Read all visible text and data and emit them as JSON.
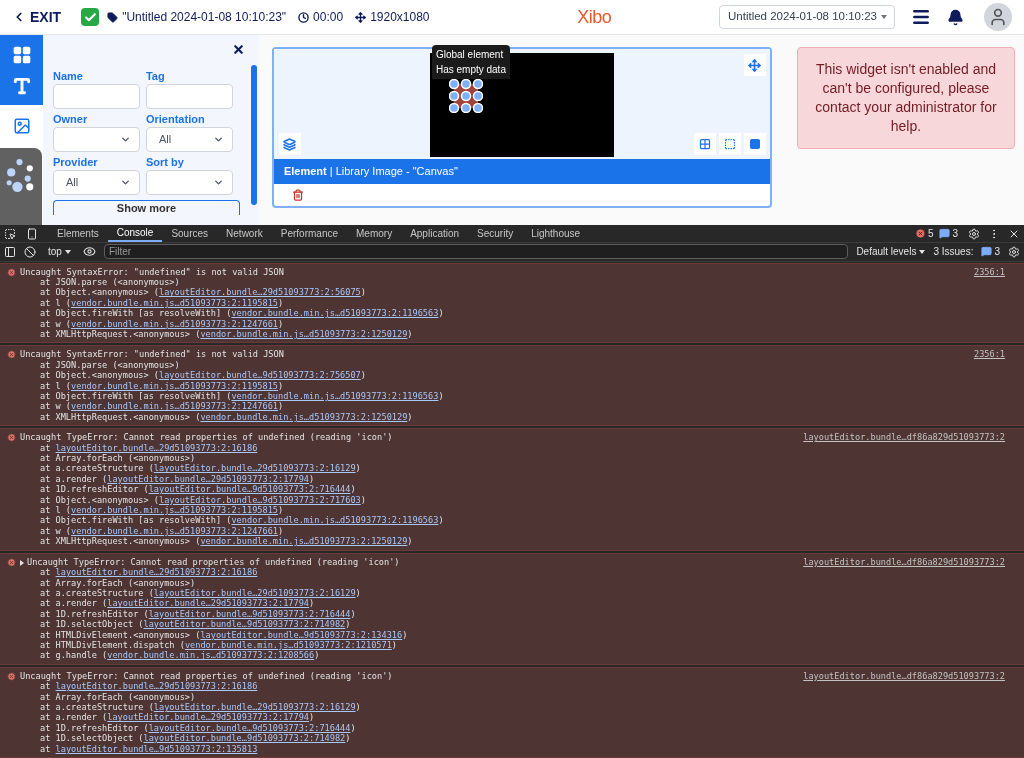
{
  "top_bar": {
    "exit": "EXIT",
    "layout_name": "\"Untitled 2024-01-08 10:10:23\"",
    "duration": "00:00",
    "resolution": "1920x1080",
    "logo": "Xibo",
    "layout_select": "Untitled 2024-01-08 10:10:23"
  },
  "toolbox": {
    "filters": [
      {
        "label": "Name",
        "kind": "input"
      },
      {
        "label": "Tag",
        "kind": "input"
      },
      {
        "label": "Owner",
        "kind": "select"
      },
      {
        "label": "Orientation",
        "kind": "select",
        "value": "All"
      },
      {
        "label": "Provider",
        "kind": "select",
        "value": "All"
      },
      {
        "label": "Sort by",
        "kind": "select"
      }
    ],
    "show_more": "Show more"
  },
  "canvas": {
    "tooltip": [
      "Global element",
      "Has empty data"
    ],
    "element_bar": "**Element** | Library Image - \"Canvas\""
  },
  "warning": "This widget isn't enabled and can't be configured, please contact your administrator for help.",
  "devtools": {
    "tabs": [
      {
        "label": "Elements",
        "selected": false
      },
      {
        "label": "Console",
        "selected": true
      },
      {
        "label": "Sources",
        "selected": false
      },
      {
        "label": "Network",
        "selected": false
      },
      {
        "label": "Performance",
        "selected": false
      },
      {
        "label": "Memory",
        "selected": false
      },
      {
        "label": "Application",
        "selected": false
      },
      {
        "label": "Security",
        "selected": false
      },
      {
        "label": "Lighthouse",
        "selected": false
      }
    ],
    "error_count": "5",
    "message_count": "3",
    "context": "top",
    "filter_placeholder": "Filter",
    "levels": "Default levels",
    "issues_label": "3 Issues:",
    "issues_count": "3"
  },
  "messages": [
    {
      "expandable": false,
      "text": "Uncaught SyntaxError: \"undefined\" is not valid JSON",
      "source": "2356:1",
      "frames": [
        {
          "text": "at JSON.parse (<anonymous>)"
        },
        {
          "text": "at Object.<anonymous> (",
          "link": "layoutEditor.bundle…29d51093773:2:56075",
          "end": ")"
        },
        {
          "text": "at l (",
          "link": "vendor.bundle.min.js…d51093773:2:1195815",
          "end": ")"
        },
        {
          "text": "at Object.fireWith [as resolveWith] (",
          "link": "vendor.bundle.min.js…d51093773:2:1196563",
          "end": ")"
        },
        {
          "text": "at w (",
          "link": "vendor.bundle.min.js…d51093773:2:1247661",
          "end": ")"
        },
        {
          "text": "at XMLHttpRequest.<anonymous> (",
          "link": "vendor.bundle.min.js…d51093773:2:1250129",
          "end": ")"
        }
      ]
    },
    {
      "expandable": false,
      "text": "Uncaught SyntaxError: \"undefined\" is not valid JSON",
      "source": "2356:1",
      "frames": [
        {
          "text": "at JSON.parse (<anonymous>)"
        },
        {
          "text": "at Object.<anonymous> (",
          "link": "layoutEditor.bundle…9d51093773:2:756507",
          "end": ")"
        },
        {
          "text": "at l (",
          "link": "vendor.bundle.min.js…d51093773:2:1195815",
          "end": ")"
        },
        {
          "text": "at Object.fireWith [as resolveWith] (",
          "link": "vendor.bundle.min.js…d51093773:2:1196563",
          "end": ")"
        },
        {
          "text": "at w (",
          "link": "vendor.bundle.min.js…d51093773:2:1247661",
          "end": ")"
        },
        {
          "text": "at XMLHttpRequest.<anonymous> (",
          "link": "vendor.bundle.min.js…d51093773:2:1250129",
          "end": ")"
        }
      ]
    },
    {
      "expandable": false,
      "text": "Uncaught TypeError: Cannot read properties of undefined (reading 'icon')",
      "source": "layoutEditor.bundle…df86a829d51093773:2",
      "frames": [
        {
          "text": "at ",
          "link": "layoutEditor.bundle…29d51093773:2:16186"
        },
        {
          "text": "at Array.forEach (<anonymous>)"
        },
        {
          "text": "at a.createStructure (",
          "link": "layoutEditor.bundle…29d51093773:2:16129",
          "end": ")"
        },
        {
          "text": "at a.render (",
          "link": "layoutEditor.bundle…29d51093773:2:17794",
          "end": ")"
        },
        {
          "text": "at 1D.refreshEditor (",
          "link": "layoutEditor.bundle…9d51093773:2:716444",
          "end": ")"
        },
        {
          "text": "at Object.<anonymous> (",
          "link": "layoutEditor.bundle…9d51093773:2:717603",
          "end": ")"
        },
        {
          "text": "at l (",
          "link": "vendor.bundle.min.js…d51093773:2:1195815",
          "end": ")"
        },
        {
          "text": "at Object.fireWith [as resolveWith] (",
          "link": "vendor.bundle.min.js…d51093773:2:1196563",
          "end": ")"
        },
        {
          "text": "at w (",
          "link": "vendor.bundle.min.js…d51093773:2:1247661",
          "end": ")"
        },
        {
          "text": "at XMLHttpRequest.<anonymous> (",
          "link": "vendor.bundle.min.js…d51093773:2:1250129",
          "end": ")"
        }
      ]
    },
    {
      "expandable": true,
      "text": "Uncaught TypeError: Cannot read properties of undefined (reading 'icon')",
      "source": "layoutEditor.bundle…df86a829d51093773:2",
      "frames": [
        {
          "text": "at ",
          "link": "layoutEditor.bundle…29d51093773:2:16186"
        },
        {
          "text": "at Array.forEach (<anonymous>)"
        },
        {
          "text": "at a.createStructure (",
          "link": "layoutEditor.bundle…29d51093773:2:16129",
          "end": ")"
        },
        {
          "text": "at a.render (",
          "link": "layoutEditor.bundle…29d51093773:2:17794",
          "end": ")"
        },
        {
          "text": "at 1D.refreshEditor (",
          "link": "layoutEditor.bundle…9d51093773:2:716444",
          "end": ")"
        },
        {
          "text": "at 1D.selectObject (",
          "link": "layoutEditor.bundle…9d51093773:2:714982",
          "end": ")"
        },
        {
          "text": "at HTMLDivElement.<anonymous> (",
          "link": "layoutEditor.bundle…9d51093773:2:134316",
          "end": ")"
        },
        {
          "text": "at HTMLDivElement.dispatch (",
          "link": "vendor.bundle.min.js…d51093773:2:1210571",
          "end": ")"
        },
        {
          "text": "at g.handle (",
          "link": "vendor.bundle.min.js…d51093773:2:1208566",
          "end": ")"
        }
      ]
    },
    {
      "expandable": false,
      "text": "Uncaught TypeError: Cannot read properties of undefined (reading 'icon')",
      "source": "layoutEditor.bundle…df86a829d51093773:2",
      "frames": [
        {
          "text": "at ",
          "link": "layoutEditor.bundle…29d51093773:2:16186"
        },
        {
          "text": "at Array.forEach (<anonymous>)"
        },
        {
          "text": "at a.createStructure (",
          "link": "layoutEditor.bundle…29d51093773:2:16129",
          "end": ")"
        },
        {
          "text": "at a.render (",
          "link": "layoutEditor.bundle…29d51093773:2:17794",
          "end": ")"
        },
        {
          "text": "at 1D.refreshEditor (",
          "link": "layoutEditor.bundle…9d51093773:2:716444",
          "end": ")"
        },
        {
          "text": "at 1D.selectObject (",
          "link": "layoutEditor.bundle…9d51093773:2:714982",
          "end": ")"
        },
        {
          "text": "at ",
          "link": "layoutEditor.bundle…9d51093773:2:135813"
        }
      ]
    }
  ]
}
